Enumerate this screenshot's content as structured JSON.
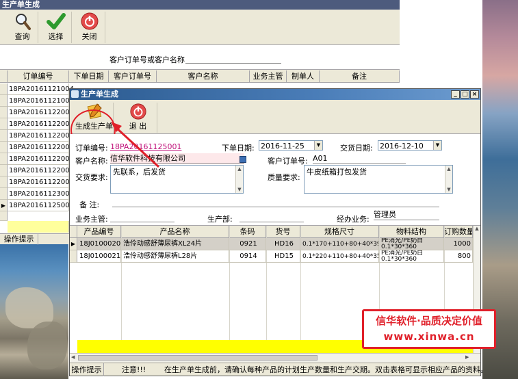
{
  "back_window": {
    "title": "生产单生成",
    "toolbar": {
      "query_label": "查询",
      "select_label": "选择",
      "close_label": "关闭"
    },
    "search": {
      "label": "客户订单号或客户名称",
      "value": ""
    },
    "grid": {
      "columns": [
        "订单编号",
        "下单日期",
        "客户订单号",
        "客户名称",
        "业务主管",
        "制单人",
        "备注"
      ],
      "rows": [
        "18PA20161121004",
        "18PA20161121005",
        "18PA20161122001",
        "18PA20161122002",
        "18PA20161122003",
        "18PA20161122004",
        "18PA20161122005",
        "18PA20161122006",
        "18PA20161122007",
        "18PA20161123001",
        "18PA20161125001"
      ],
      "current_row_marker": "▶"
    },
    "status_label": "操作提示"
  },
  "dialog": {
    "title": "生产单生成",
    "window_buttons": {
      "minimize": "_",
      "maximize": "□",
      "close": "×"
    },
    "toolbar": {
      "generate_label": "生成生产单",
      "exit_label": "退 出"
    },
    "form": {
      "order_no_label": "订单编号:",
      "order_no_value": "18PA20161125001",
      "order_date_label": "下单日期:",
      "order_date_value": "2016-11-25",
      "delivery_date_label": "交货日期:",
      "delivery_date_value": "2016-12-10",
      "customer_name_label": "客户名称:",
      "customer_name_value": "信华软件科技有限公司",
      "customer_order_label": "客户订单号:",
      "customer_order_value": "A01",
      "delivery_req_label": "交货要求:",
      "delivery_req_value": "先联系，后发货",
      "quality_req_label": "质量要求:",
      "quality_req_value": "牛皮纸箱打包发货",
      "remark_label": "备  注:",
      "remark_value": "",
      "sales_mgr_label": "业务主管:",
      "sales_mgr_value": "",
      "production_dept_label": "生产部:",
      "production_dept_value": "",
      "handler_label": "经办业务:",
      "handler_value": "管理员"
    },
    "grid": {
      "columns": [
        "产品编号",
        "产品名称",
        "条码",
        "货号",
        "规格尺寸",
        "物料结构",
        "订购数量"
      ],
      "rows": [
        {
          "code": "18J0100020",
          "name": "浩伶动感舒薄尿裤XL24片",
          "barcode": "0921",
          "item_no": "HD16",
          "spec": "0.1*170+110+80+40*390",
          "material_1": "PE消光/PE奶白",
          "material_2": "0.1*30*360",
          "qty": "1000"
        },
        {
          "code": "18J0100021",
          "name": "浩伶动感舒薄尿裤L28片",
          "barcode": "0914",
          "item_no": "HD15",
          "spec": "0.1*220+110+80+40*350",
          "material_1": "PE消光/PE奶白",
          "material_2": "0.1*30*360",
          "qty": "800"
        }
      ],
      "current_row_marker": "▶"
    },
    "status": {
      "label": "操作提示",
      "note": "注意!!!",
      "message": "在生产单生成前，请确认每种产品的计划生产数量和生产交期。双击表格可显示相应产品的资料。"
    }
  },
  "watermark": {
    "line1": "信华软件·品质决定价值",
    "line2": "www.xinwa.cn"
  },
  "colors": {
    "highlight_red": "#e0202a",
    "title_blue": "#2b5a8f",
    "summary_yellow": "#ffff00",
    "link_pink": "#c0107a"
  }
}
